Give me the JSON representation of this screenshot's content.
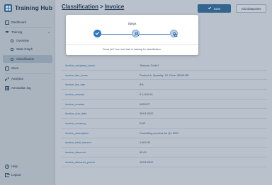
{
  "app": {
    "name": "Training Hub"
  },
  "nav": {
    "dashboard": "Dashboard",
    "training": "Training",
    "overview": "Overview",
    "state_graph": "State Graph",
    "classification": "Classification",
    "store": "Store",
    "analytics": "Analytics",
    "annotation_log": "Annotation log",
    "help": "Help",
    "logout": "Logout"
  },
  "header": {
    "crumb_parent": "Classification",
    "separator": ">",
    "crumb_current": "Invoice",
    "save_label": "Save",
    "add_label": "Add datapoints"
  },
  "modal": {
    "title": "Steps",
    "message": "Great job! Your next task is training for classification."
  },
  "table": {
    "rows": [
      {
        "key": "invoice_company_name",
        "value": "Telecom GmbH"
      },
      {
        "key": "invoice_line_items",
        "value": "Product A, Quantity: 10, Price: $100USD"
      },
      {
        "key": "invoice_tax_rate",
        "value": "8%"
      },
      {
        "key": "invoice_amount",
        "value": "€ 1,000.00"
      },
      {
        "key": "invoice_number",
        "value": "9362977"
      },
      {
        "key": "invoice_due_date",
        "value": "28/01/2022"
      },
      {
        "key": "invoice_currency",
        "value": "EUR"
      },
      {
        "key": "invoice_description",
        "value": "Consulting services for Q1 2022"
      },
      {
        "key": "invoice_total_amount",
        "value": "1,000.00"
      },
      {
        "key": "invoice_discount",
        "value": "50.00"
      },
      {
        "key": "invoice_discount_period",
        "value": "10/01/2022"
      }
    ]
  },
  "colors": {
    "accent": "#34658f",
    "step_active": "#2d78c0",
    "link": "#2d6290"
  }
}
